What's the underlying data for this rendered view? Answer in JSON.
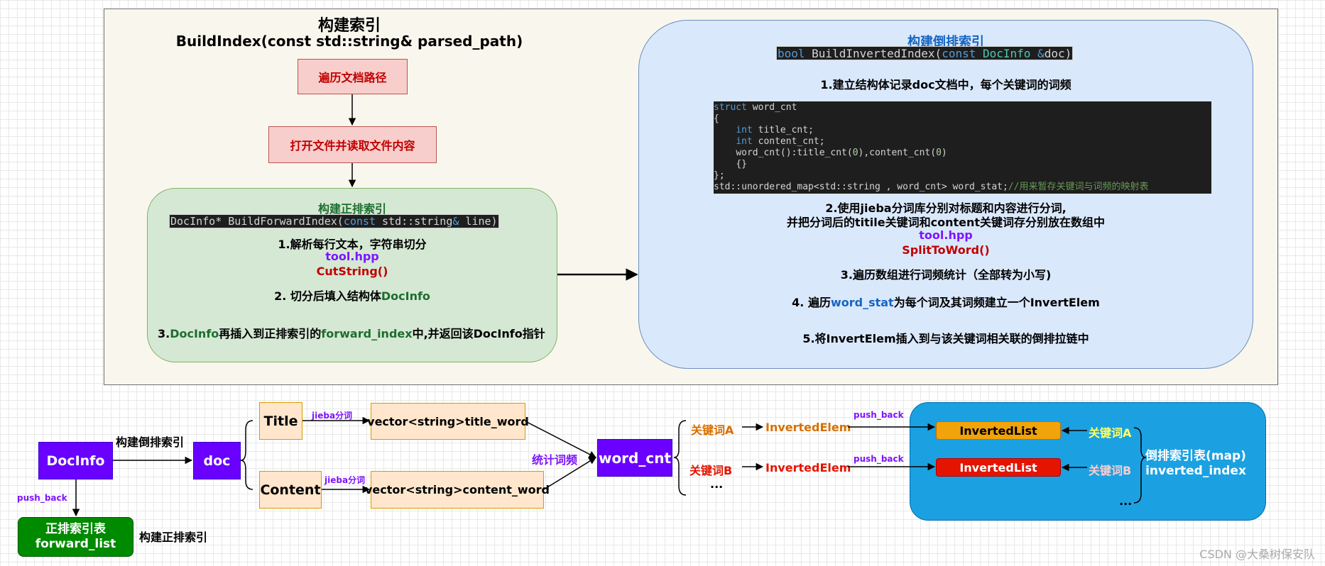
{
  "top": {
    "title_cn": "构建索引",
    "title_sig": "BuildIndex(const std::string& parsed_path)",
    "step_traverse": "遍历文档路径",
    "step_open": "打开文件并读取文件内容"
  },
  "forward": {
    "title": "构建正排索引",
    "sig_type": "DocInfo*",
    "sig_name": " BuildForwardIndex(",
    "sig_const": "const",
    "sig_std": " std::string",
    "sig_amp": "&",
    "sig_end": " line)",
    "step1": "1.解析每行文本，字符串切分",
    "tool": "tool.hpp",
    "func": "CutString()",
    "step2_a": "2. 切分后填入结构体",
    "step2_b": "DocInfo",
    "step3_a": "3.",
    "step3_b": "DocInfo",
    "step3_c": "再插入到正排索引的",
    "step3_d": "forward_index",
    "step3_e": "中,并返回该DocInfo指针"
  },
  "inverted": {
    "title": "构建倒排索引",
    "sig_bool": "bool",
    "sig_name": " BuildInvertedIndex(",
    "sig_const": "const",
    "sig_type": " DocInfo ",
    "sig_amp": "&",
    "sig_end": "doc)",
    "step1": "1.建立结构体记录doc文档中，每个关键词的词频",
    "code": {
      "l1_kw": "struct",
      "l1_rest": " word_cnt",
      "l2": "{",
      "l3_kw": "int",
      "l3_rest": " title_cnt;",
      "l4_kw": "int",
      "l4_rest": " content_cnt;",
      "l5_a": "word_cnt():title_cnt(",
      "l5_n1": "0",
      "l5_b": "),content_cnt(",
      "l5_n2": "0",
      "l5_c": ")",
      "l6": "{}",
      "l7": "};",
      "l8_code": "std::unordered_map<std::string , word_cnt> word_stat;",
      "l8_comment": "//用来暂存关键词与词频的映射表"
    },
    "step2_l1": "2.使用jieba分词库分别对标题和内容进行分词,",
    "step2_l2": "并把分词后的titile关键词和content关键词存分别放在数组中",
    "tool": "tool.hpp",
    "func": "SplitToWord()",
    "step3": "3.遍历数组进行词频统计（全部转为小写)",
    "step4_a": "4. 遍历",
    "step4_b": "word_stat",
    "step4_c": "为每个词及其词频建立一个InvertElem",
    "step5": "5.将InvertElem插入到与该关键词相关联的倒排拉链中"
  },
  "bottom": {
    "docinfo": "DocInfo",
    "build_inverted": "构建倒排索引",
    "doc": "doc",
    "push_back": "push_back",
    "forward_list_l1": "正排索引表",
    "forward_list_l2": "forward_list",
    "build_forward": "构建正排索引",
    "title": "Title",
    "content": "Content",
    "jieba1": "jieba分词",
    "jieba2": "jieba分词",
    "vec_title": "vector<string>title_word",
    "vec_content": "vector<string>content_word",
    "count": "统计词频",
    "word_cnt": "word_cnt",
    "kwA": "关键词A",
    "kwB": "关键词B",
    "ellipsis1": "...",
    "elemA": "InvertedElem",
    "elemB": "InvertedElem",
    "pb1": "push_back",
    "pb2": "push_back",
    "listA": "InvertedList",
    "listB": "InvertedList",
    "kwA2": "关键词A",
    "kwB2": "关键词B",
    "ellipsis2": "...",
    "map_l1": "倒排索引表(map)",
    "map_l2": "inverted_index"
  },
  "watermark": "CSDN @大桑树保安队",
  "colors": {
    "panel_bg": "#f9f7ed",
    "forward_bg": "#d5e8d4",
    "inverted_bg": "#dae8fc",
    "purple_node": "#6a00ff",
    "map_bg": "#1ba1e2",
    "listA": "#f0a30a",
    "listB": "#e51400"
  }
}
